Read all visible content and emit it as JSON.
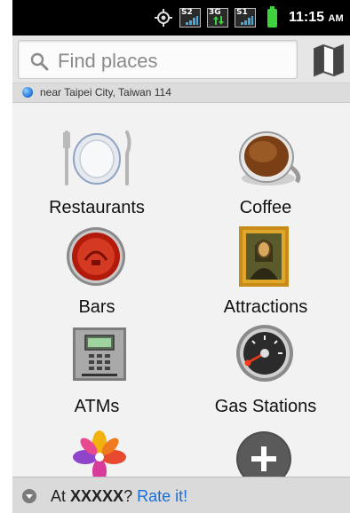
{
  "status_bar": {
    "signal_1": "S2",
    "signal_2": "3G",
    "signal_3": "S1",
    "time": "11:15",
    "ampm": "AM"
  },
  "search": {
    "placeholder": "Find places"
  },
  "location": {
    "text": "near Taipei City, Taiwan 114"
  },
  "categories": [
    {
      "label": "Restaurants",
      "icon": "plate-icon"
    },
    {
      "label": "Coffee",
      "icon": "coffee-cup-icon"
    },
    {
      "label": "Bars",
      "icon": "bottle-cap-icon"
    },
    {
      "label": "Attractions",
      "icon": "mona-lisa-icon"
    },
    {
      "label": "ATMs",
      "icon": "atm-icon"
    },
    {
      "label": "Gas Stations",
      "icon": "fuel-gauge-icon"
    },
    {
      "label": "",
      "icon": "pinwheel-icon"
    },
    {
      "label": "",
      "icon": "add-icon"
    }
  ],
  "rate_bar": {
    "prefix": "At",
    "place": "XXXXX",
    "question": "?",
    "link": "Rate it!"
  },
  "colors": {
    "link": "#1a6ed8",
    "battery": "#3fd23f"
  }
}
